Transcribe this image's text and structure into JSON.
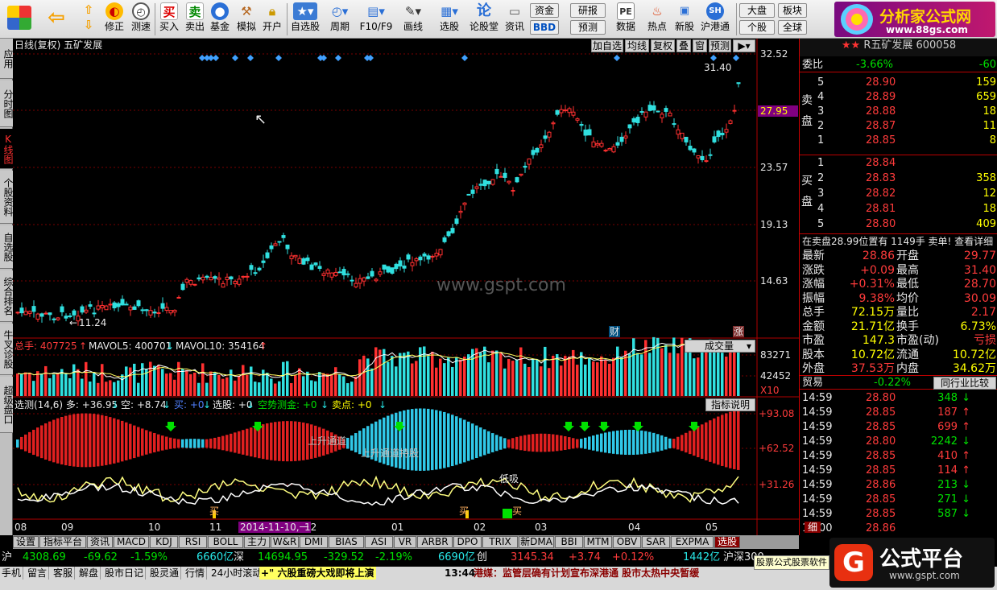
{
  "toolbar": {
    "buttons": [
      "",
      "",
      "修正",
      "测速",
      "买入",
      "卖出",
      "基金",
      "模拟",
      "开户",
      "自选股",
      "周期",
      "F10/F9",
      "画线",
      "选股",
      "论股堂",
      "资讯",
      "数据",
      "热点",
      "新股",
      "沪港通"
    ],
    "buy_icon": "买",
    "sell_icon": "卖",
    "box1": "资金",
    "box2": "BBD",
    "box3": "研报",
    "box4": "预测",
    "box5": "大盘",
    "box6": "个股",
    "box7": "板块",
    "box8": "全球",
    "logo_title": "分析家公式网",
    "logo_url": "www.88gs.com"
  },
  "left_tabs": [
    "应用",
    "分时图",
    "K线图",
    "个股资料",
    "自选股",
    "综合排名",
    "牛叉诊股",
    "超级盘口"
  ],
  "chart": {
    "title": "日线(复权)  五矿发展",
    "top_buttons": [
      "加自选",
      "均线",
      "复权",
      "叠",
      "窗",
      "预测"
    ],
    "price_axis": [
      "32.52",
      "27.95",
      "23.57",
      "19.13",
      "14.63"
    ],
    "current_price_tag": "27.95",
    "high_mark": "31.40",
    "low_mark": "11.24",
    "badge_cai": "财",
    "badge_zhang": "涨",
    "watermark": "www.gspt.com",
    "vol": {
      "label1": "总手: 407725",
      "label2": "MAVOL5: 400701",
      "label3": "MAVOL10: 354164",
      "selector": "成交量",
      "axis": [
        "83271",
        "42452",
        "X10"
      ]
    },
    "ind": {
      "header": [
        "选测(14,6) 多: +36.95",
        "空: +8.74",
        "买: +0",
        "选股: +0",
        "空势测金: +0",
        "卖点: +0"
      ],
      "explain_button": "指标说明",
      "axis": [
        "+93.08",
        "+62.52",
        "+31.26"
      ],
      "ann_buy1": "买",
      "ann_buy2": "买",
      "ann_buy3": "买",
      "ann_low": "低吸",
      "ann_up1": "上升通道",
      "ann_up2": "上升通道持股"
    },
    "x_axis": [
      "08",
      "09",
      "10",
      "11",
      "12",
      "01",
      "02",
      "03",
      "04",
      "05"
    ],
    "date_tag": "2014-11-10,一"
  },
  "right_panel": {
    "stock_name": "R五矿发展  600058",
    "wei_label": "委比",
    "wei_val": "-3.66%",
    "wei_diff": "-60",
    "sell_side": "卖盘",
    "asks": [
      {
        "lv": "5",
        "p": "28.90",
        "v": "159"
      },
      {
        "lv": "4",
        "p": "28.89",
        "v": "659"
      },
      {
        "lv": "3",
        "p": "28.88",
        "v": "18"
      },
      {
        "lv": "2",
        "p": "28.87",
        "v": "11"
      },
      {
        "lv": "1",
        "p": "28.85",
        "v": "8"
      }
    ],
    "buy_side": "买盘",
    "bids": [
      {
        "lv": "1",
        "p": "28.84",
        "v": ""
      },
      {
        "lv": "2",
        "p": "28.83",
        "v": "358"
      },
      {
        "lv": "3",
        "p": "28.82",
        "v": "12"
      },
      {
        "lv": "4",
        "p": "28.81",
        "v": "18"
      },
      {
        "lv": "5",
        "p": "28.80",
        "v": "409"
      }
    ],
    "notice": "在卖盘28.99位置有  1149手  卖单!  查看详细",
    "stats": [
      {
        "k1": "最新",
        "v1": "28.86",
        "k2": "开盘",
        "v2": "29.77"
      },
      {
        "k1": "涨跌",
        "v1": "+0.09",
        "k2": "最高",
        "v2": "31.40"
      },
      {
        "k1": "涨幅",
        "v1": "+0.31%",
        "k2": "最低",
        "v2": "28.70"
      },
      {
        "k1": "振幅",
        "v1": "9.38%",
        "k2": "均价",
        "v2": "30.09"
      },
      {
        "k1": "总手",
        "v1": "72.15万",
        "k2": "量比",
        "v2": "2.17"
      },
      {
        "k1": "金额",
        "v1": "21.71亿",
        "k2": "换手",
        "v2": "6.73%"
      },
      {
        "k1": "市盈",
        "v1": "147.3",
        "k2": "市盈(动)",
        "v2": "亏损"
      },
      {
        "k1": "股本",
        "v1": "10.72亿",
        "k2": "流通",
        "v2": "10.72亿"
      },
      {
        "k1": "外盘",
        "v1": "37.53万",
        "k2": "内盘",
        "v2": "34.62万"
      }
    ],
    "sector": "贸易",
    "sector_chg": "-0.22%",
    "peer_button": "同行业比较",
    "ticks": [
      {
        "t": "14:59",
        "p": "28.80",
        "v": "348",
        "d": "down"
      },
      {
        "t": "14:59",
        "p": "28.85",
        "v": "187",
        "d": "up"
      },
      {
        "t": "14:59",
        "p": "28.85",
        "v": "699",
        "d": "up"
      },
      {
        "t": "14:59",
        "p": "28.80",
        "v": "2242",
        "d": "down"
      },
      {
        "t": "14:59",
        "p": "28.85",
        "v": "410",
        "d": "up"
      },
      {
        "t": "14:59",
        "p": "28.85",
        "v": "114",
        "d": "up"
      },
      {
        "t": "14:59",
        "p": "28.86",
        "v": "213",
        "d": "down"
      },
      {
        "t": "14:59",
        "p": "28.85",
        "v": "271",
        "d": "down"
      },
      {
        "t": "14:59",
        "p": "28.85",
        "v": "587",
        "d": "down"
      },
      {
        "t": "15:00",
        "p": "28.86",
        "v": "",
        "d": ""
      }
    ],
    "tab_detail": "细"
  },
  "bottom_tabs": [
    "设置",
    "指标平台",
    "资讯",
    "MACD",
    "KDJ",
    "RSI",
    "BOLL",
    "主力",
    "W&R",
    "DMI",
    "BIAS",
    "ASI",
    "VR",
    "ARBR",
    "DPO",
    "TRIX",
    "新DMA",
    "BBI",
    "MTM",
    "OBV",
    "SAR",
    "EXPMA",
    "选股"
  ],
  "ticker": {
    "sh_label": "沪",
    "sh_idx": "4308.69",
    "sh_chg": "-69.62",
    "sh_pct": "-1.59%",
    "sh_amt": "6660亿",
    "sz_label": "深",
    "sz_idx": "14694.95",
    "sz_chg": "-329.52",
    "sz_pct": "-2.19%",
    "sz_amt": "6690亿",
    "cy_label": "创",
    "cy_idx": "3145.34",
    "cy_chg": "+3.74",
    "cy_pct": "+0.12%",
    "cy_amt": "1442亿",
    "hs_label": "沪深300"
  },
  "status": {
    "items": [
      "手机",
      "留言",
      "客服",
      "解盘",
      "股市日记",
      "股灵通",
      "行情",
      "24小时滚动"
    ],
    "news1": "+\" 六股重磅大戏即将上演",
    "time": "13:44",
    "news2": "港媒：监管层确有计划宣布深港通 股市太热中央暂缓",
    "popup": "股票公式股票软件",
    "brand": "公式平台",
    "brand_url": "www.gspt.com"
  }
}
